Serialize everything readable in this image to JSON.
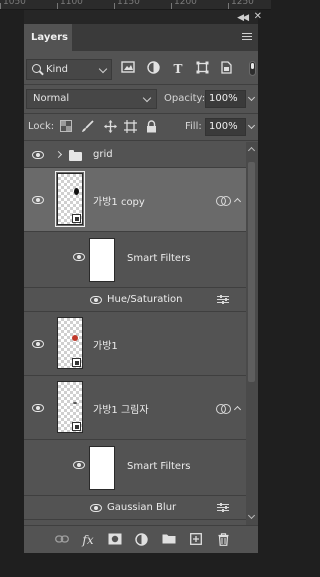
{
  "ruler": {
    "ticks": [
      "1050",
      "1100",
      "1150",
      "1200",
      "1250"
    ]
  },
  "panel": {
    "tab_label": "Layers",
    "filter": {
      "kind_label": "Kind",
      "icons": [
        "image-filter-icon",
        "adjustment-filter-icon",
        "type-filter-icon",
        "shape-filter-icon",
        "smart-object-filter-icon"
      ]
    },
    "blend_mode": "Normal",
    "opacity_label": "Opacity:",
    "opacity_value": "100%",
    "lock_label": "Lock:",
    "fill_label": "Fill:",
    "fill_value": "100%"
  },
  "layers": [
    {
      "type": "group",
      "name": "grid",
      "visible": true
    },
    {
      "type": "smart-object",
      "name": "가방1 copy",
      "visible": true,
      "selected": true,
      "smart_filters_label": "Smart Filters",
      "filter_name": "Hue/Saturation"
    },
    {
      "type": "smart-object",
      "name": "가방1",
      "visible": true,
      "mark_color": "#c0392b"
    },
    {
      "type": "smart-object",
      "name": "가방1 그림자",
      "visible": true,
      "smart_filters_label": "Smart Filters",
      "filter_name": "Gaussian Blur"
    }
  ],
  "bottom_bar": {
    "icons": [
      "link-layers-icon",
      "fx-icon",
      "add-mask-icon",
      "adjustment-layer-icon",
      "new-group-icon",
      "new-layer-icon",
      "delete-icon"
    ],
    "fx_label": "fx"
  }
}
